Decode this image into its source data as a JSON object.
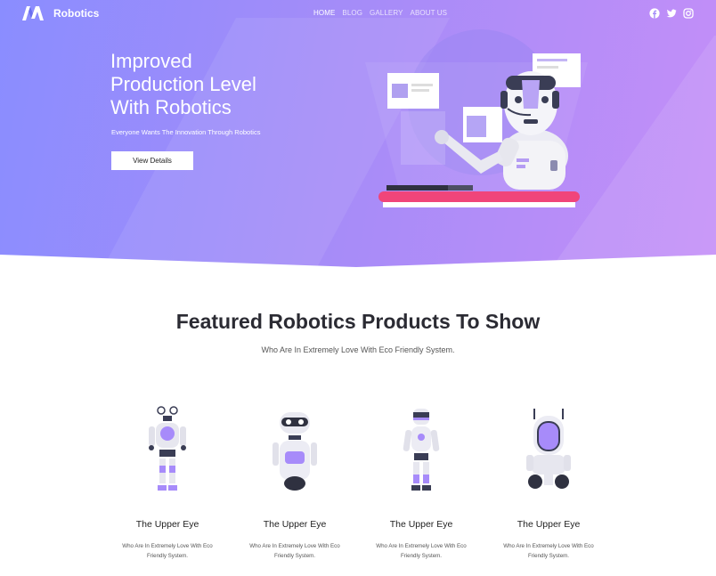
{
  "nav": {
    "brand": "Robotics",
    "menu": [
      {
        "label": "HOME",
        "active": true
      },
      {
        "label": "BLOG",
        "active": false
      },
      {
        "label": "GALLERY",
        "active": false
      },
      {
        "label": "ABOUT US",
        "active": false
      }
    ],
    "social_icons": [
      "facebook-icon",
      "twitter-icon",
      "instagram-icon"
    ]
  },
  "hero": {
    "title": "Improved Production Level With Robotics",
    "subtitle": "Everyone Wants The Innovation Through Robotics",
    "button_label": "View Details"
  },
  "featured": {
    "title": "Featured Robotics Products To Show",
    "subtitle": "Who Are In Extremely Love With Eco Friendly System."
  },
  "products": [
    {
      "name": "The Upper Eye",
      "description": "Who Are In Extremely Love With Eco Friendly System."
    },
    {
      "name": "The Upper Eye",
      "description": "Who Are In Extremely Love With Eco Friendly System."
    },
    {
      "name": "The Upper Eye",
      "description": "Who Are In Extremely Love With Eco Friendly System."
    },
    {
      "name": "The Upper Eye",
      "description": "Who Are In Extremely Love With Eco Friendly System."
    }
  ],
  "colors": {
    "hero_gradient_start": "#8a8dff",
    "hero_gradient_end": "#c48ef8",
    "accent_purple": "#a78bfa",
    "accent_pink": "#f0457a"
  }
}
